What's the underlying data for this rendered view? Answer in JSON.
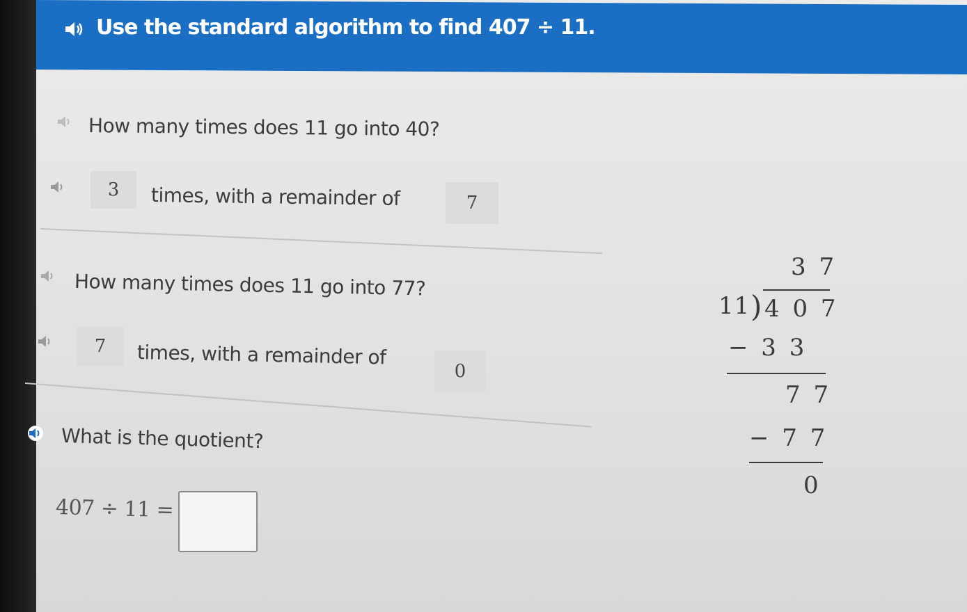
{
  "header": {
    "instruction": "Use the standard algorithm to find 407 ÷ 11."
  },
  "step1": {
    "question": "How many times does 11 go into 40?",
    "times_value": "3",
    "mid_text": "times, with a remainder of",
    "remainder_value": "7"
  },
  "step2": {
    "question": "How many times does 11 go into 77?",
    "times_value": "7",
    "mid_text": "times, with a remainder of",
    "remainder_value": "0"
  },
  "step3": {
    "question": "What is the quotient?",
    "equation": "407 ÷ 11 =",
    "answer_value": ""
  },
  "long_division": {
    "quotient": "3 7",
    "divisor": "11",
    "dividend": "4 0 7",
    "subtract1": "− 3 3",
    "remainder1": "7 7",
    "subtract2": "− 7 7",
    "remainder2": "0"
  },
  "colors": {
    "header_blue": "#1a6fc4",
    "header_text": "#ffffff"
  },
  "icons": [
    "speaker-icon"
  ]
}
